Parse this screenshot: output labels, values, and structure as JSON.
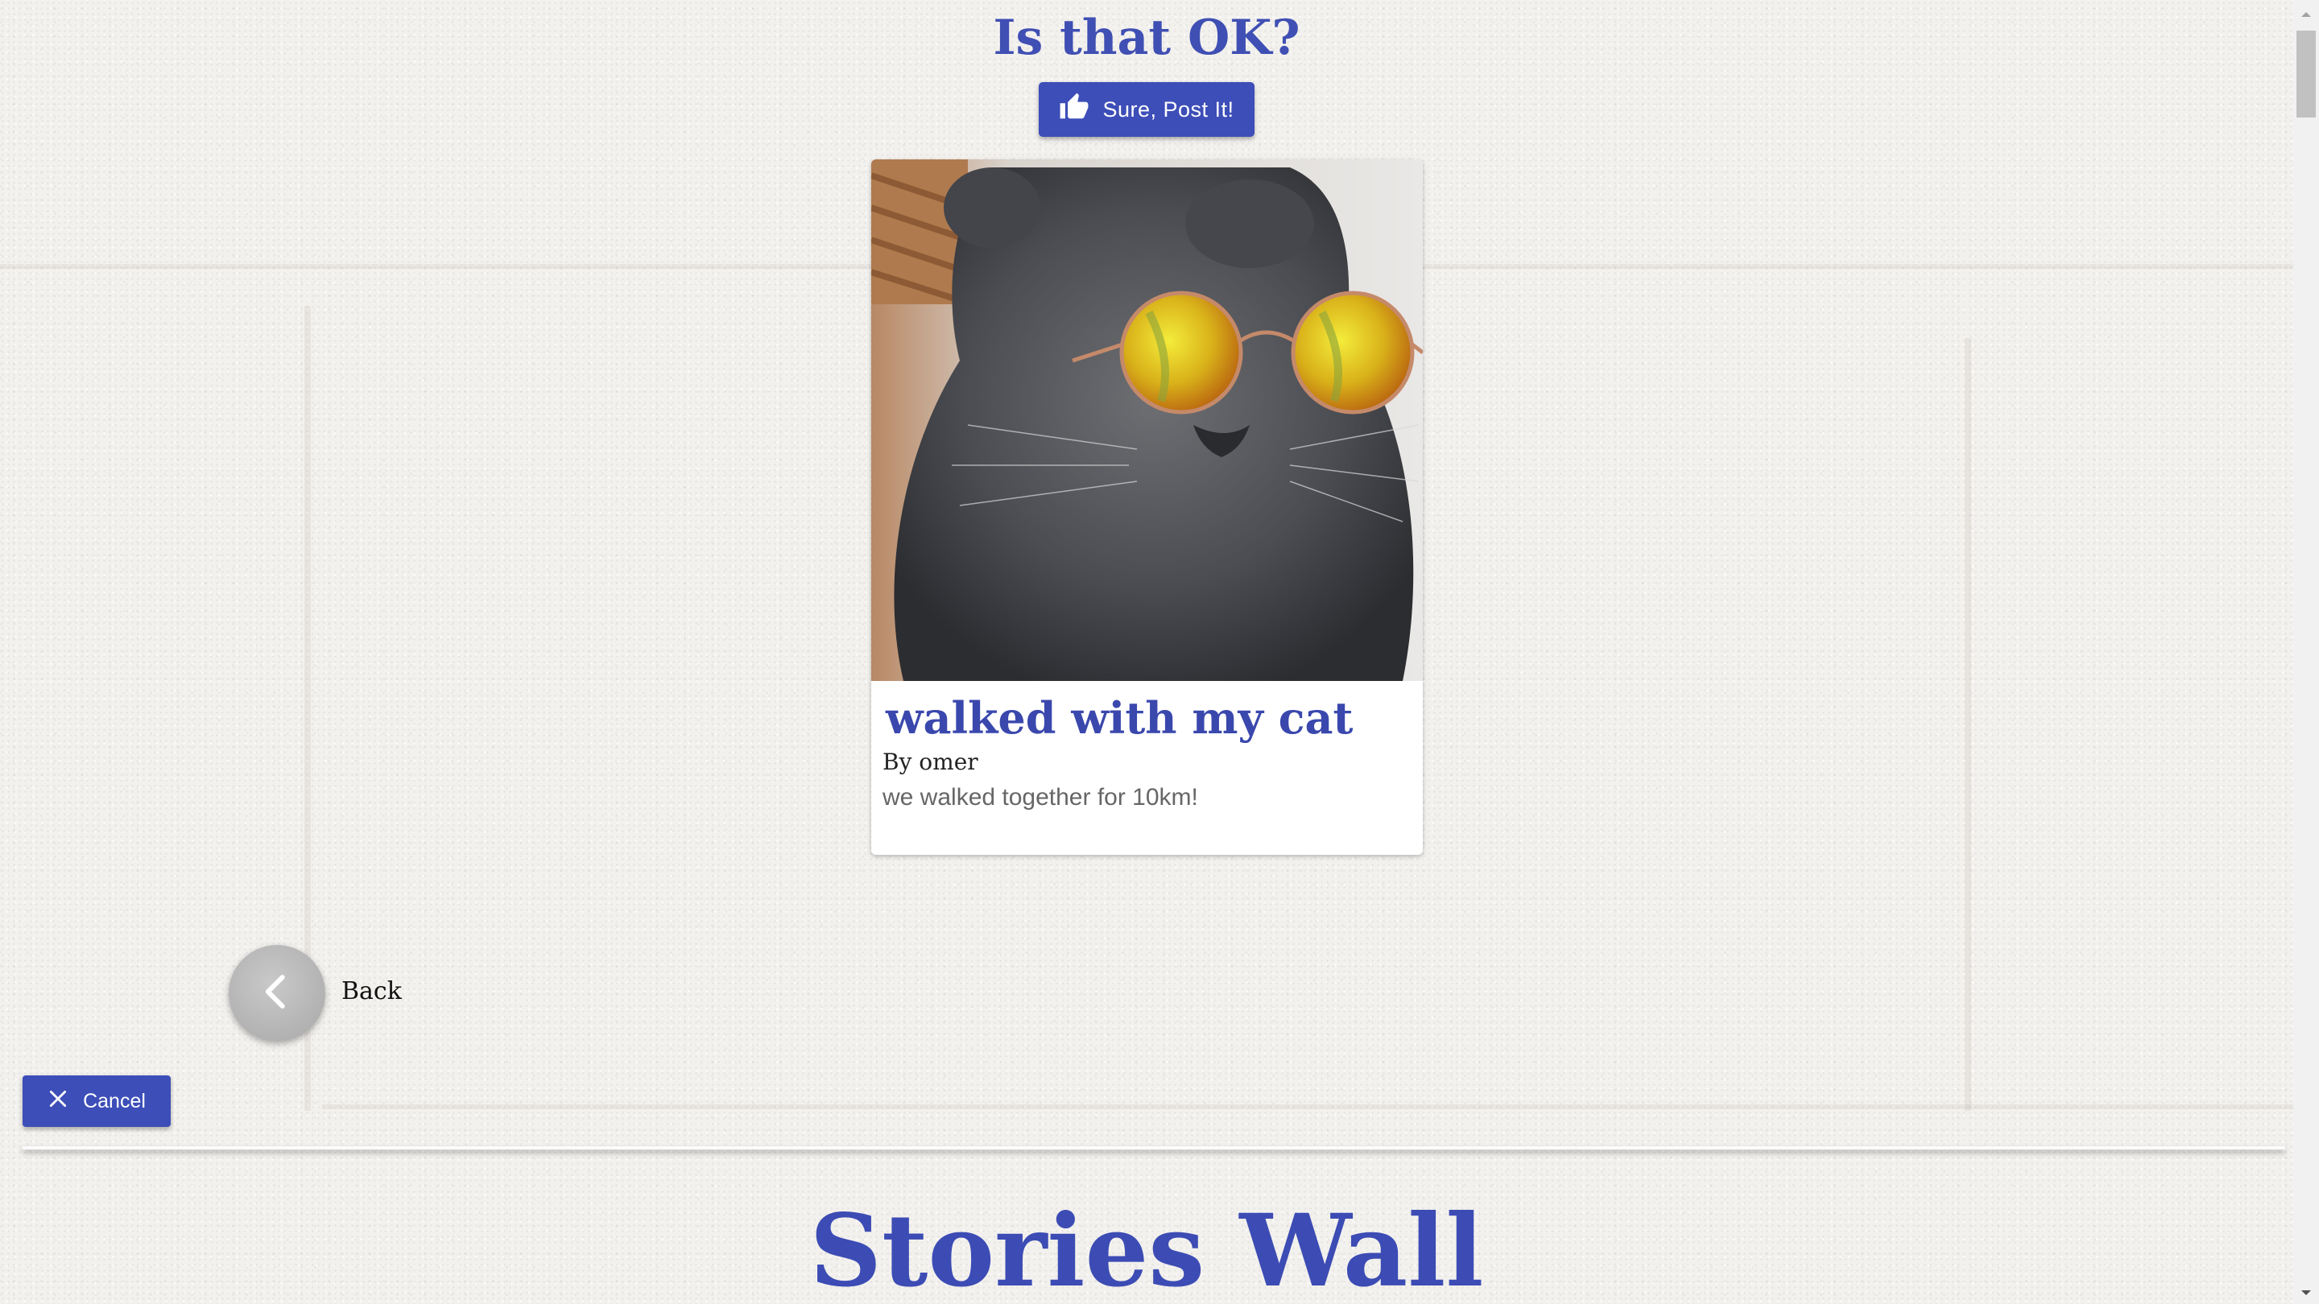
{
  "confirm": {
    "heading": "Is that OK?",
    "post_label": "Sure, Post It!",
    "post_icon": "thumbs-up-icon"
  },
  "story": {
    "title": "walked with my cat",
    "author": "By omer",
    "body": "we walked together for 10km!",
    "image_subject": "grey cat wearing yellow mirrored round sunglasses"
  },
  "navigation": {
    "back_label": "Back",
    "back_icon": "chevron-left-icon",
    "cancel_label": "Cancel",
    "cancel_icon": "close-icon"
  },
  "wall": {
    "heading": "Stories Wall"
  },
  "colors": {
    "accent": "#3d4eb8",
    "heading": "#3f4fb3",
    "background": "#f3f1ee"
  }
}
